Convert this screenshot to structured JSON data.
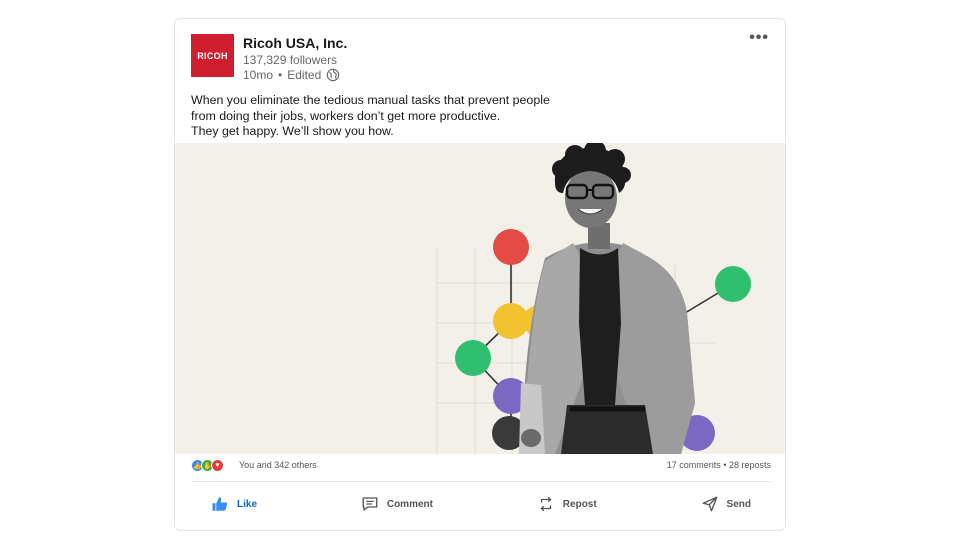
{
  "post": {
    "org_name": "Ricoh USA, Inc.",
    "logo_text": "RICOH",
    "followers": "137,329 followers",
    "age": "10mo",
    "edited": "Edited",
    "separator": "•",
    "more_label": "•••",
    "text_lines": [
      "When you eliminate the tedious manual tasks that prevent people",
      "from doing their jobs, workers don’t get more productive.",
      "They get happy. We’ll show you how."
    ]
  },
  "media": {
    "background": "#f3efe9",
    "dot_colors": [
      "#e44b45",
      "#f2c230",
      "#2fbf6f",
      "#7b68c2",
      "#3a3a3a"
    ],
    "icons": [
      "network-diagram-graphic",
      "person-photo"
    ]
  },
  "social": {
    "reaction_icons": [
      "like-reaction-icon",
      "celebrate-reaction-icon",
      "love-reaction-icon"
    ],
    "reaction_colors": [
      "#378fe9",
      "#44a74b",
      "#df3d3d"
    ],
    "reactions_text": "You and 342 others",
    "comments": "17 comments",
    "dot": "•",
    "reposts": "28 reposts"
  },
  "actions": [
    {
      "label": "Like",
      "icon": "thumbs-up-icon"
    },
    {
      "label": "Comment",
      "icon": "comment-icon"
    },
    {
      "label": "Repost",
      "icon": "repost-icon"
    },
    {
      "label": "Send",
      "icon": "send-icon"
    }
  ],
  "colors": {
    "accent": "#0a66c2",
    "logo_bg": "#cf1f2e"
  }
}
